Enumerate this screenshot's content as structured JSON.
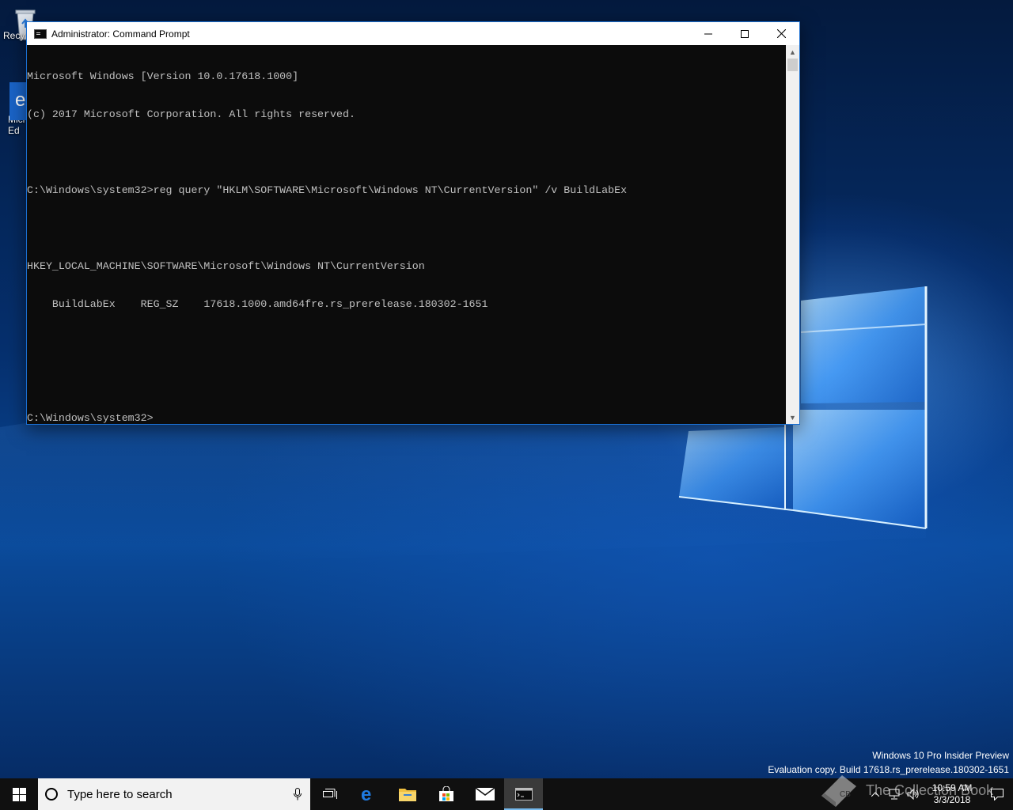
{
  "desktop": {
    "icons": [
      {
        "label": "Recy",
        "icon": "recycle-bin-icon"
      },
      {
        "label": "Micr\nEd",
        "icon": "edge-shortcut-icon"
      }
    ]
  },
  "window": {
    "title": "Administrator: Command Prompt",
    "icon": "command-prompt-icon",
    "console_lines": [
      "Microsoft Windows [Version 10.0.17618.1000]",
      "(c) 2017 Microsoft Corporation. All rights reserved.",
      "",
      "C:\\Windows\\system32>reg query \"HKLM\\SOFTWARE\\Microsoft\\Windows NT\\CurrentVersion\" /v BuildLabEx",
      "",
      "HKEY_LOCAL_MACHINE\\SOFTWARE\\Microsoft\\Windows NT\\CurrentVersion",
      "    BuildLabEx    REG_SZ    17618.1000.amd64fre.rs_prerelease.180302-1651",
      "",
      "",
      "C:\\Windows\\system32>"
    ]
  },
  "watermark": {
    "line1": "Windows 10 Pro Insider Preview",
    "line2": "Evaluation copy. Build 17618.rs_prerelease.180302-1651"
  },
  "taskbar": {
    "search_placeholder": "Type here to search",
    "apps": [
      "task-view-icon",
      "edge-icon",
      "file-explorer-icon",
      "store-icon",
      "mail-icon",
      "command-prompt-icon"
    ],
    "clock_time": "10:59 AM",
    "clock_date": "3/3/2018"
  },
  "brand_overlay": "The Collection Book",
  "colors": {
    "accent": "#1a6fd1",
    "console_bg": "#0c0c0c",
    "console_fg": "#c0c0c0",
    "taskbar_bg": "#101010",
    "taskbar_active_indicator": "#76b9ed"
  }
}
